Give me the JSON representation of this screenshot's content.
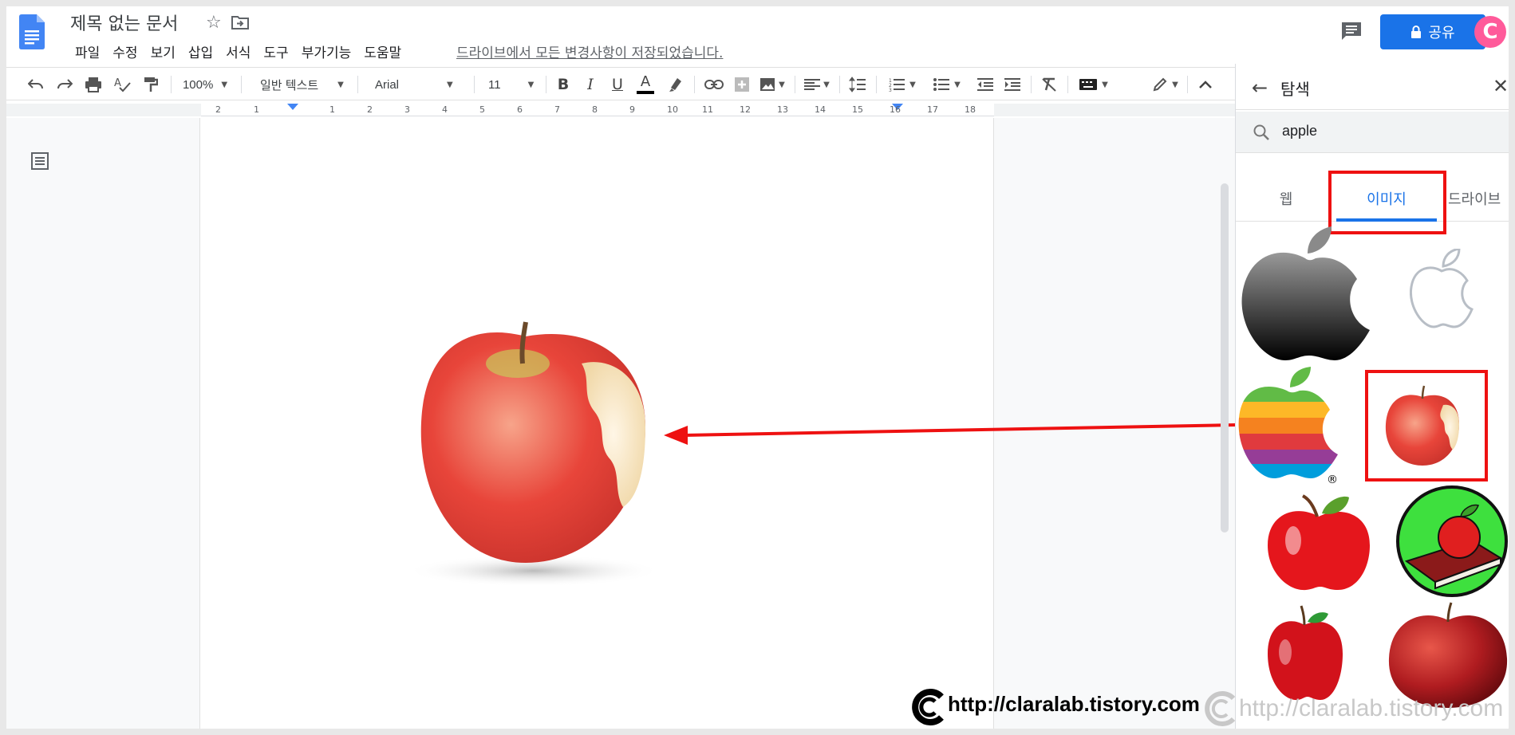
{
  "header": {
    "doc_title": "제목 없는 문서",
    "menu": [
      "파일",
      "수정",
      "보기",
      "삽입",
      "서식",
      "도구",
      "부가기능",
      "도움말"
    ],
    "save_status": "드라이브에서 모든 변경사항이 저장되었습니다.",
    "share_label": "공유",
    "avatar_letter": "C"
  },
  "toolbar": {
    "zoom": "100%",
    "style": "일반 텍스트",
    "font": "Arial",
    "size": "11"
  },
  "ruler": {
    "numbers": [
      "2",
      "1",
      "1",
      "2",
      "3",
      "4",
      "5",
      "6",
      "7",
      "8",
      "9",
      "10",
      "11",
      "12",
      "13",
      "14",
      "15",
      "16",
      "17",
      "18"
    ]
  },
  "explore": {
    "title": "탐색",
    "search_value": "apple",
    "tabs": [
      "웹",
      "이미지",
      "드라이브"
    ],
    "active_tab": "이미지"
  },
  "watermark": {
    "text": "http://claralab.tistory.com",
    "text_faded": "http://claralab.tistory.com"
  },
  "colors": {
    "accent": "#1a73e8",
    "highlight_red": "#ee1111"
  }
}
